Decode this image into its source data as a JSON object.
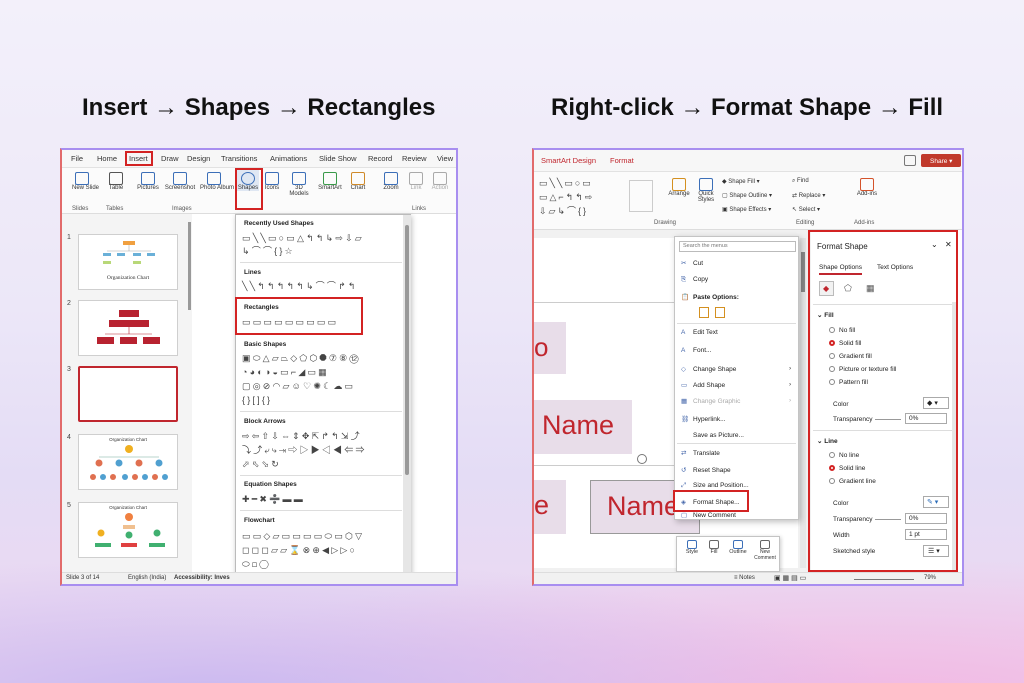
{
  "headings": {
    "left": "Insert → Shapes → Rectangles",
    "right": "Right-click → Format Shape → Fill"
  },
  "colors": {
    "accent": "#d32323",
    "panel_border": "#a88ef0",
    "shape_fill": "#e8dde9",
    "shape_text": "#c0262e"
  },
  "left": {
    "tabs": [
      "File",
      "Home",
      "Insert",
      "Draw",
      "Design",
      "Transitions",
      "Animations",
      "Slide Show",
      "Record",
      "Review",
      "View"
    ],
    "ribbon_buttons": [
      {
        "label": "New Slide",
        "icon": "new-slide-icon"
      },
      {
        "label": "Table",
        "icon": "table-icon"
      },
      {
        "label": "Pictures",
        "icon": "pictures-icon"
      },
      {
        "label": "Screenshot",
        "icon": "screenshot-icon"
      },
      {
        "label": "Photo Album",
        "icon": "photo-album-icon"
      },
      {
        "label": "Shapes",
        "icon": "shapes-icon"
      },
      {
        "label": "Icons",
        "icon": "icons-icon"
      },
      {
        "label": "3D Models",
        "icon": "3d-models-icon"
      },
      {
        "label": "SmartArt",
        "icon": "smartart-icon"
      },
      {
        "label": "Chart",
        "icon": "chart-icon"
      },
      {
        "label": "Zoom",
        "icon": "zoom-icon"
      },
      {
        "label": "Link",
        "icon": "link-icon"
      },
      {
        "label": "Action",
        "icon": "action-icon"
      }
    ],
    "groups": {
      "slides": "Slides",
      "tables": "Tables",
      "images": "Images",
      "links": "Links"
    },
    "slides": [
      {
        "num": "1",
        "title": "Organization Chart"
      },
      {
        "num": "2",
        "title": ""
      },
      {
        "num": "3",
        "title": ""
      },
      {
        "num": "4",
        "title": "Organization Chart"
      },
      {
        "num": "5",
        "title": "Organization Chart"
      }
    ],
    "gallery": {
      "recently_used": "Recently Used Shapes",
      "lines": "Lines",
      "rectangles": "Rectangles",
      "basic_shapes": "Basic Shapes",
      "block_arrows": "Block Arrows",
      "equation_shapes": "Equation Shapes",
      "flowchart": "Flowchart",
      "glyphs": {
        "recent1": "▭╲╲▭○▭△↰↰↳⇨⇩▱",
        "recent2": "↳⌒⌒{}☆",
        "lines": "╲╲↰↰↰↰↰↳⌒⌒↱↰",
        "rect": "▭▭▭▭▭▭▭▭▭",
        "basic1": "▣⬭△▱⏢◇⬠⬡⯃⑦⑧⑫",
        "basic2": "◔◕◐◑◒▭⌐◢▭▦",
        "basic3": "▢◎⊘◠▱☺♡✺☾☁▭",
        "basic4": "{}[]{}",
        "arrows1": "⇨⇦⇧⇩⇔⇕✥⇱↱↰⇲⤴",
        "arrows2": "⤵⤴⤶⤷⇥⇨▷▶◁◀⇐⇒",
        "arrows3": "⬀⬁⬂↻",
        "eq": "✚━✖➗▬▬",
        "flow1": "▭▭◇▱▭▭▭▭⬭▭⬡▽",
        "flow2": "◻◻◻▱▱⌛⊗⊕◀▷▷○",
        "flow3": "⬭◻◯"
      }
    },
    "status": {
      "slide": "Slide 3 of 14",
      "lang": "English (India)",
      "access": "Accessibility: Inves"
    }
  },
  "right": {
    "tabs": {
      "smartart": "SmartArt Design",
      "format": "Format"
    },
    "share": "Share",
    "ribbon": {
      "arrange": "Arrange",
      "quick": "Quick Styles",
      "shape_fill": "Shape Fill",
      "shape_outline": "Shape Outline",
      "shape_effects": "Shape Effects",
      "find": "Find",
      "replace": "Replace",
      "select": "Select",
      "addins": "Add-ins",
      "g_drawing": "Drawing",
      "g_editing": "Editing",
      "g_addins": "Add-ins"
    },
    "shapes": [
      "Name",
      "Name",
      "e",
      "o"
    ],
    "menu": {
      "search": "Search the menus",
      "items": [
        {
          "label": "Cut",
          "icon": "✂"
        },
        {
          "label": "Copy",
          "icon": "⎘"
        },
        {
          "label": "Paste Options:",
          "icon": "📋"
        },
        {
          "label": "Edit Text",
          "icon": "A"
        },
        {
          "label": "Font...",
          "icon": "A"
        },
        {
          "label": "Change Shape",
          "icon": "◇"
        },
        {
          "label": "Add Shape",
          "icon": "▭"
        },
        {
          "label": "Change Graphic",
          "icon": "▦"
        },
        {
          "label": "Hyperlink...",
          "icon": "⛓"
        },
        {
          "label": "Save as Picture...",
          "icon": ""
        },
        {
          "label": "Translate",
          "icon": "⇄"
        },
        {
          "label": "Reset Shape",
          "icon": "↺"
        },
        {
          "label": "Size and Position...",
          "icon": "⤢"
        },
        {
          "label": "Format Shape...",
          "icon": "◈"
        },
        {
          "label": "New Comment",
          "icon": "▢"
        }
      ]
    },
    "mini": {
      "style": "Style",
      "fill": "Fill",
      "outline": "Outline",
      "comment": "New Comment"
    },
    "pane": {
      "title": "Format Shape",
      "tabs": {
        "shape": "Shape Options",
        "text": "Text Options"
      },
      "fill": {
        "title": "Fill",
        "opts": [
          "No fill",
          "Solid fill",
          "Gradient fill",
          "Picture or texture fill",
          "Pattern fill"
        ],
        "color": "Color",
        "transparency": "Transparency",
        "trans_val": "0%"
      },
      "line": {
        "title": "Line",
        "opts": [
          "No line",
          "Solid line",
          "Gradient line"
        ],
        "color": "Color",
        "transparency": "Transparency",
        "trans_val": "0%",
        "width": "Width",
        "width_val": "1 pt",
        "sketched": "Sketched style"
      }
    },
    "status": {
      "notes": "Notes",
      "zoom": "79%"
    }
  }
}
